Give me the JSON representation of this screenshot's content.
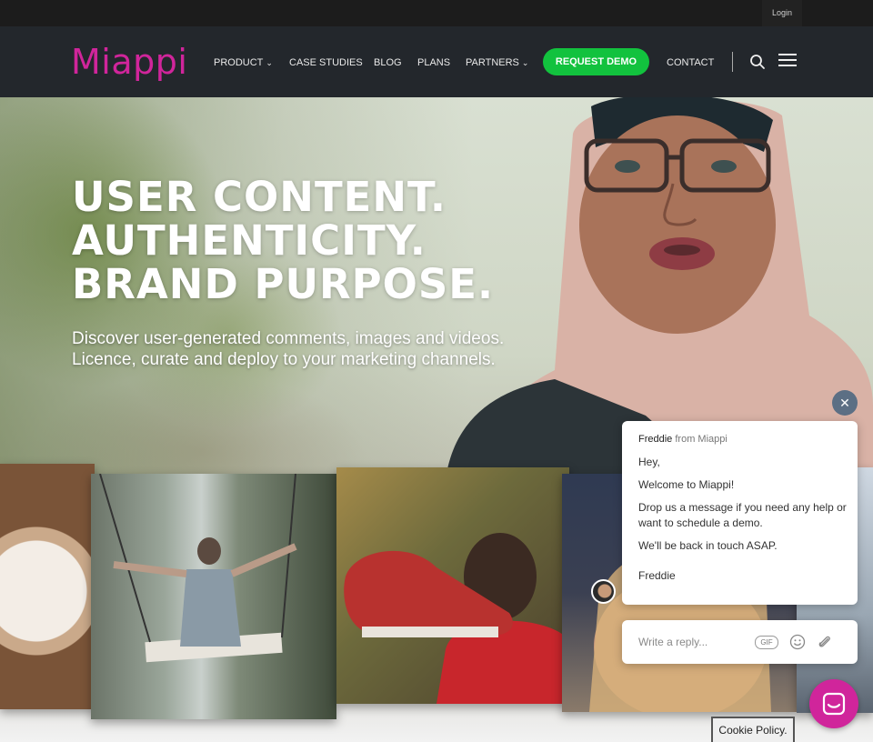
{
  "topbar": {
    "login_label": "Login"
  },
  "brand": {
    "name": "Miappi",
    "color": "#d0259b"
  },
  "nav": {
    "items": [
      {
        "label": "PRODUCT",
        "has_dropdown": true
      },
      {
        "label": "CASE STUDIES",
        "has_dropdown": false
      },
      {
        "label": "BLOG",
        "has_dropdown": false
      },
      {
        "label": "PLANS",
        "has_dropdown": false
      },
      {
        "label": "PARTNERS",
        "has_dropdown": true
      }
    ],
    "cta_label": "REQUEST DEMO",
    "cta_color": "#12c23e",
    "contact_label": "CONTACT",
    "search_icon": "search-icon",
    "menu_icon": "hamburger-menu-icon"
  },
  "hero": {
    "title_lines": [
      "USER CONTENT.",
      "AUTHENTICITY.",
      "BRAND PURPOSE."
    ],
    "subtitle_lines": [
      "Discover user-generated comments, images and videos.",
      "Licence, curate and deploy to your marketing channels."
    ]
  },
  "chat": {
    "agent_name": "Freddie",
    "from_org": "from Miappi",
    "messages": [
      "Hey,",
      "Welcome to Miappi!",
      "Drop us a message if you need any help or want to schedule a demo.",
      "We'll be back in touch ASAP.",
      "Freddie"
    ],
    "reply_placeholder": "Write a reply...",
    "gif_label": "GIF",
    "close_icon": "close-icon",
    "emoji_icon": "emoji-icon",
    "attach_icon": "paperclip-icon",
    "launcher_icon": "chat-launcher-icon"
  },
  "cookie": {
    "label": "Cookie Policy."
  }
}
